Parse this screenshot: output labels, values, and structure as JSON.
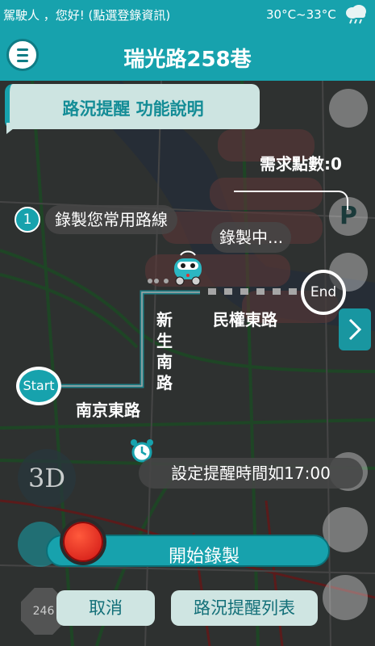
{
  "status": {
    "greeting": "駕駛人 ，您好! (點選登錄資訊)",
    "temperature": "30°C~33°C",
    "weather_icon": "rain-cloud-icon"
  },
  "header": {
    "title": "瑞光路258巷",
    "menu_icon": "menu-icon"
  },
  "help": {
    "banner_label": "路況提醒  功能說明",
    "points_label": "需求點數:0",
    "step_number": "1",
    "step_text": "錄製您常用路線",
    "recording_text": "錄製中...",
    "reminder_text": "設定提醒時間如17:00"
  },
  "route": {
    "start_label": "Start",
    "end_label": "End",
    "road_minquan": "民權東路",
    "road_xinsheng": "新生南路",
    "road_nanjing": "南京東路"
  },
  "map": {
    "left_3d": "3D",
    "speed_limit": "246"
  },
  "actions": {
    "record_label": "開始錄製",
    "cancel_label": "取消",
    "list_label": "路況提醒列表"
  },
  "colors": {
    "primary": "#17a2ad",
    "record_red": "#d9201a",
    "button_bg": "#cfe5e2"
  }
}
